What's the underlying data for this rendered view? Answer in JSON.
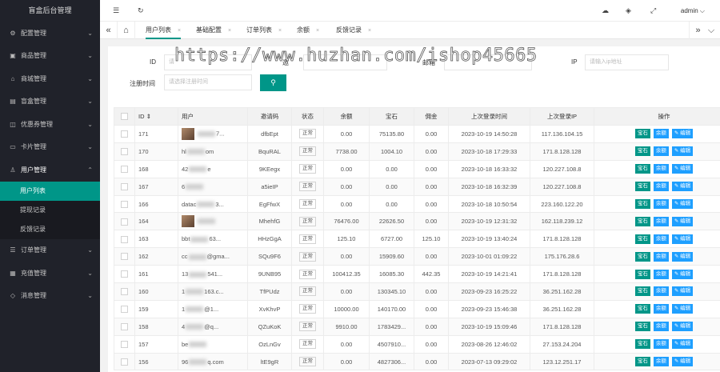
{
  "sidebar": {
    "brand": "盲盒后台管理",
    "items": [
      {
        "label": "配置管理",
        "icon": "settings-icon",
        "glyph": "⚙"
      },
      {
        "label": "商品管理",
        "icon": "goods-icon",
        "glyph": "▣"
      },
      {
        "label": "商城管理",
        "icon": "shop-icon",
        "glyph": "⌂"
      },
      {
        "label": "盲盒管理",
        "icon": "box-icon",
        "glyph": "▤"
      },
      {
        "label": "优惠券管理",
        "icon": "coupon-icon",
        "glyph": "◫"
      },
      {
        "label": "卡片管理",
        "icon": "card-icon",
        "glyph": "▭"
      },
      {
        "label": "用户管理",
        "icon": "user-icon",
        "glyph": "♙"
      },
      {
        "label": "订单管理",
        "icon": "order-icon",
        "glyph": "☰"
      },
      {
        "label": "充值管理",
        "icon": "recharge-icon",
        "glyph": "▦"
      },
      {
        "label": "消息管理",
        "icon": "message-icon",
        "glyph": "◇"
      }
    ],
    "user_submenu": [
      "用户列表",
      "提现记录",
      "反馈记录"
    ]
  },
  "header": {
    "menu_glyph": "☰",
    "refresh_glyph": "↻",
    "theme_glyph": "☁",
    "tag_glyph": "◈",
    "fullscreen_glyph": "⤢",
    "admin": "admin",
    "admin_chevron": "⌵"
  },
  "tabs": {
    "left_nav": "«",
    "home_glyph": "⌂",
    "right_nav": "»",
    "down_nav": "⌵",
    "close": "×",
    "items": [
      "用户列表",
      "基础配置",
      "订单列表",
      "余额",
      "反馈记录"
    ]
  },
  "filters": {
    "id_label": "ID",
    "id_placeholder": "请",
    "invite_label": "邀",
    "email_label": "邮箱",
    "ip_label": "IP",
    "ip_placeholder": "请输入ip地址",
    "regtime_label": "注册时间",
    "regtime_placeholder": "请选择注册时间",
    "search_glyph": "⚲"
  },
  "watermark": "https://www.huzhan.com/ishop45665",
  "table": {
    "headers": [
      "ID ⇕",
      "用户",
      "邀请码",
      "状态",
      "余额",
      "宝石",
      "佣金",
      "上次登录时间",
      "上次登录IP",
      "操作"
    ],
    "status_label": "正常",
    "btn_gem": "宝石",
    "btn_balance": "余额",
    "btn_edit": "✎ 编辑",
    "rows": [
      {
        "id": "171",
        "user_a": "",
        "user_b": "7...",
        "code": "dfbEpt",
        "balance": "0.00",
        "gem": "75135.80",
        "comm": "0.00",
        "time": "2023-10-19 14:50:28",
        "ip": "117.136.104.15"
      },
      {
        "id": "170",
        "user_a": "hl",
        "user_b": "om",
        "code": "BquRAL",
        "balance": "7738.00",
        "gem": "1004.10",
        "comm": "0.00",
        "time": "2023-10-18 17:29:33",
        "ip": "171.8.128.128"
      },
      {
        "id": "168",
        "user_a": "42",
        "user_b": "e",
        "code": "9KEegx",
        "balance": "0.00",
        "gem": "0.00",
        "comm": "0.00",
        "time": "2023-10-18 16:33:32",
        "ip": "120.227.108.8"
      },
      {
        "id": "167",
        "user_a": "6",
        "user_b": "",
        "code": "a5ieIP",
        "balance": "0.00",
        "gem": "0.00",
        "comm": "0.00",
        "time": "2023-10-18 16:32:39",
        "ip": "120.227.108.8"
      },
      {
        "id": "166",
        "user_a": "datac",
        "user_b": "3...",
        "code": "EgFfwX",
        "balance": "0.00",
        "gem": "0.00",
        "comm": "0.00",
        "time": "2023-10-18 10:50:54",
        "ip": "223.160.122.20"
      },
      {
        "id": "164",
        "user_a": "",
        "user_b": "",
        "code": "MhehfG",
        "balance": "76476.00",
        "gem": "22626.50",
        "comm": "0.00",
        "time": "2023-10-19 12:31:32",
        "ip": "162.118.239.12"
      },
      {
        "id": "163",
        "user_a": "bbt",
        "user_b": "63...",
        "code": "HHzGgA",
        "balance": "125.10",
        "gem": "6727.00",
        "comm": "125.10",
        "time": "2023-10-19 13:40:24",
        "ip": "171.8.128.128"
      },
      {
        "id": "162",
        "user_a": "cc",
        "user_b": "@gma...",
        "code": "SQu9F6",
        "balance": "0.00",
        "gem": "15909.60",
        "comm": "0.00",
        "time": "2023-10-01 01:09:22",
        "ip": "175.176.28.6"
      },
      {
        "id": "161",
        "user_a": "13",
        "user_b": "541...",
        "code": "9UNB95",
        "balance": "100412.35",
        "gem": "16085.30",
        "comm": "442.35",
        "time": "2023-10-19 14:21:41",
        "ip": "171.8.128.128"
      },
      {
        "id": "160",
        "user_a": "1",
        "user_b": "163.c...",
        "code": "TfPUdz",
        "balance": "0.00",
        "gem": "130345.10",
        "comm": "0.00",
        "time": "2023-09-23 16:25:22",
        "ip": "36.251.162.28"
      },
      {
        "id": "159",
        "user_a": "1",
        "user_b": "@1...",
        "code": "XvKhvP",
        "balance": "10000.00",
        "gem": "140170.00",
        "comm": "0.00",
        "time": "2023-09-23 15:46:38",
        "ip": "36.251.162.28"
      },
      {
        "id": "158",
        "user_a": "4",
        "user_b": "@q...",
        "code": "QZuKoK",
        "balance": "9910.00",
        "gem": "1783429...",
        "comm": "0.00",
        "time": "2023-10-19 15:09:46",
        "ip": "171.8.128.128"
      },
      {
        "id": "157",
        "user_a": "be",
        "user_b": "",
        "code": "OzLnGv",
        "balance": "0.00",
        "gem": "4507910...",
        "comm": "0.00",
        "time": "2023-08-26 12:46:02",
        "ip": "27.153.24.204"
      },
      {
        "id": "156",
        "user_a": "96",
        "user_b": "q.com",
        "code": "ltE9gR",
        "balance": "0.00",
        "gem": "4827306...",
        "comm": "0.00",
        "time": "2023-07-13 09:29:02",
        "ip": "123.12.251.17"
      }
    ]
  }
}
